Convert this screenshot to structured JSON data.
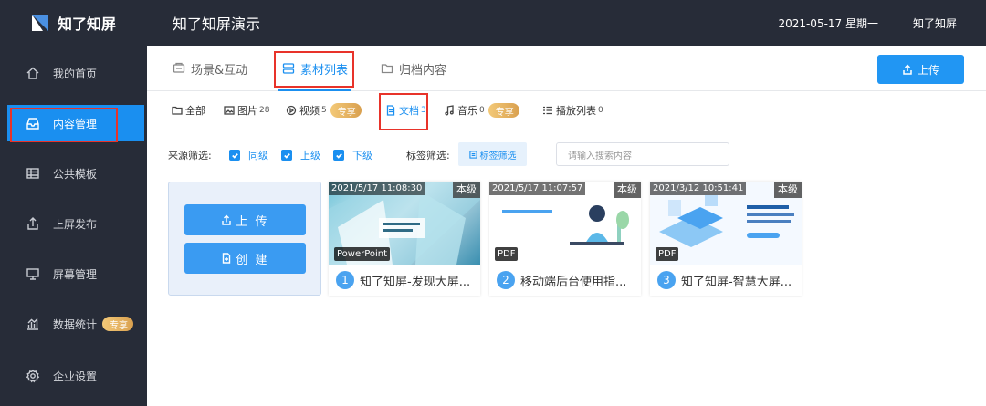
{
  "app": {
    "name": "知了知屏",
    "page_title": "知了知屏演示",
    "date": "2021-05-17 星期一",
    "user": "知了知屏"
  },
  "sidebar": {
    "items": [
      {
        "label": "我的首页",
        "icon": "home-icon"
      },
      {
        "label": "内容管理",
        "icon": "inbox-icon"
      },
      {
        "label": "公共模板",
        "icon": "table-icon"
      },
      {
        "label": "上屏发布",
        "icon": "upload-icon"
      },
      {
        "label": "屏幕管理",
        "icon": "monitor-icon"
      },
      {
        "label": "数据统计",
        "icon": "chart-icon",
        "badge": "专享"
      },
      {
        "label": "企业设置",
        "icon": "gear-icon"
      }
    ]
  },
  "tabs": [
    {
      "label": "场景&互动",
      "icon": "scene-icon"
    },
    {
      "label": "素材列表",
      "icon": "list-icon"
    },
    {
      "label": "归档内容",
      "icon": "folder-icon"
    }
  ],
  "upload_button": "上传",
  "filters": [
    {
      "label": "全部",
      "count": ""
    },
    {
      "label": "图片",
      "count": "28"
    },
    {
      "label": "视频",
      "count": "5",
      "badge": "专享"
    },
    {
      "label": "文档",
      "count": "3"
    },
    {
      "label": "音乐",
      "count": "0",
      "badge": "专享"
    },
    {
      "label": "播放列表",
      "count": "0"
    }
  ],
  "source_filter": {
    "label": "来源筛选:",
    "options": [
      "同级",
      "上级",
      "下级"
    ]
  },
  "tag_filter": {
    "label": "标签筛选:",
    "button": "标签筛选"
  },
  "search": {
    "placeholder": "请输入搜索内容"
  },
  "actions": {
    "upload": "上 传",
    "create": "创 建"
  },
  "cards": [
    {
      "timestamp": "2021/5/17 11:08:30",
      "level": "本级",
      "type": "PowerPoint",
      "index": "1",
      "title": "知了知屏-发现大屏..."
    },
    {
      "timestamp": "2021/5/17 11:07:57",
      "level": "本级",
      "type": "PDF",
      "index": "2",
      "title": "移动端后台使用指..."
    },
    {
      "timestamp": "2021/3/12 10:51:41",
      "level": "本级",
      "type": "PDF",
      "index": "3",
      "title": "知了知屏-智慧大屏..."
    }
  ],
  "colors": {
    "sidebar": "#272c38",
    "accent": "#1a8ff0",
    "highlight": "#e8332a",
    "vip": "#e0ac5c"
  }
}
